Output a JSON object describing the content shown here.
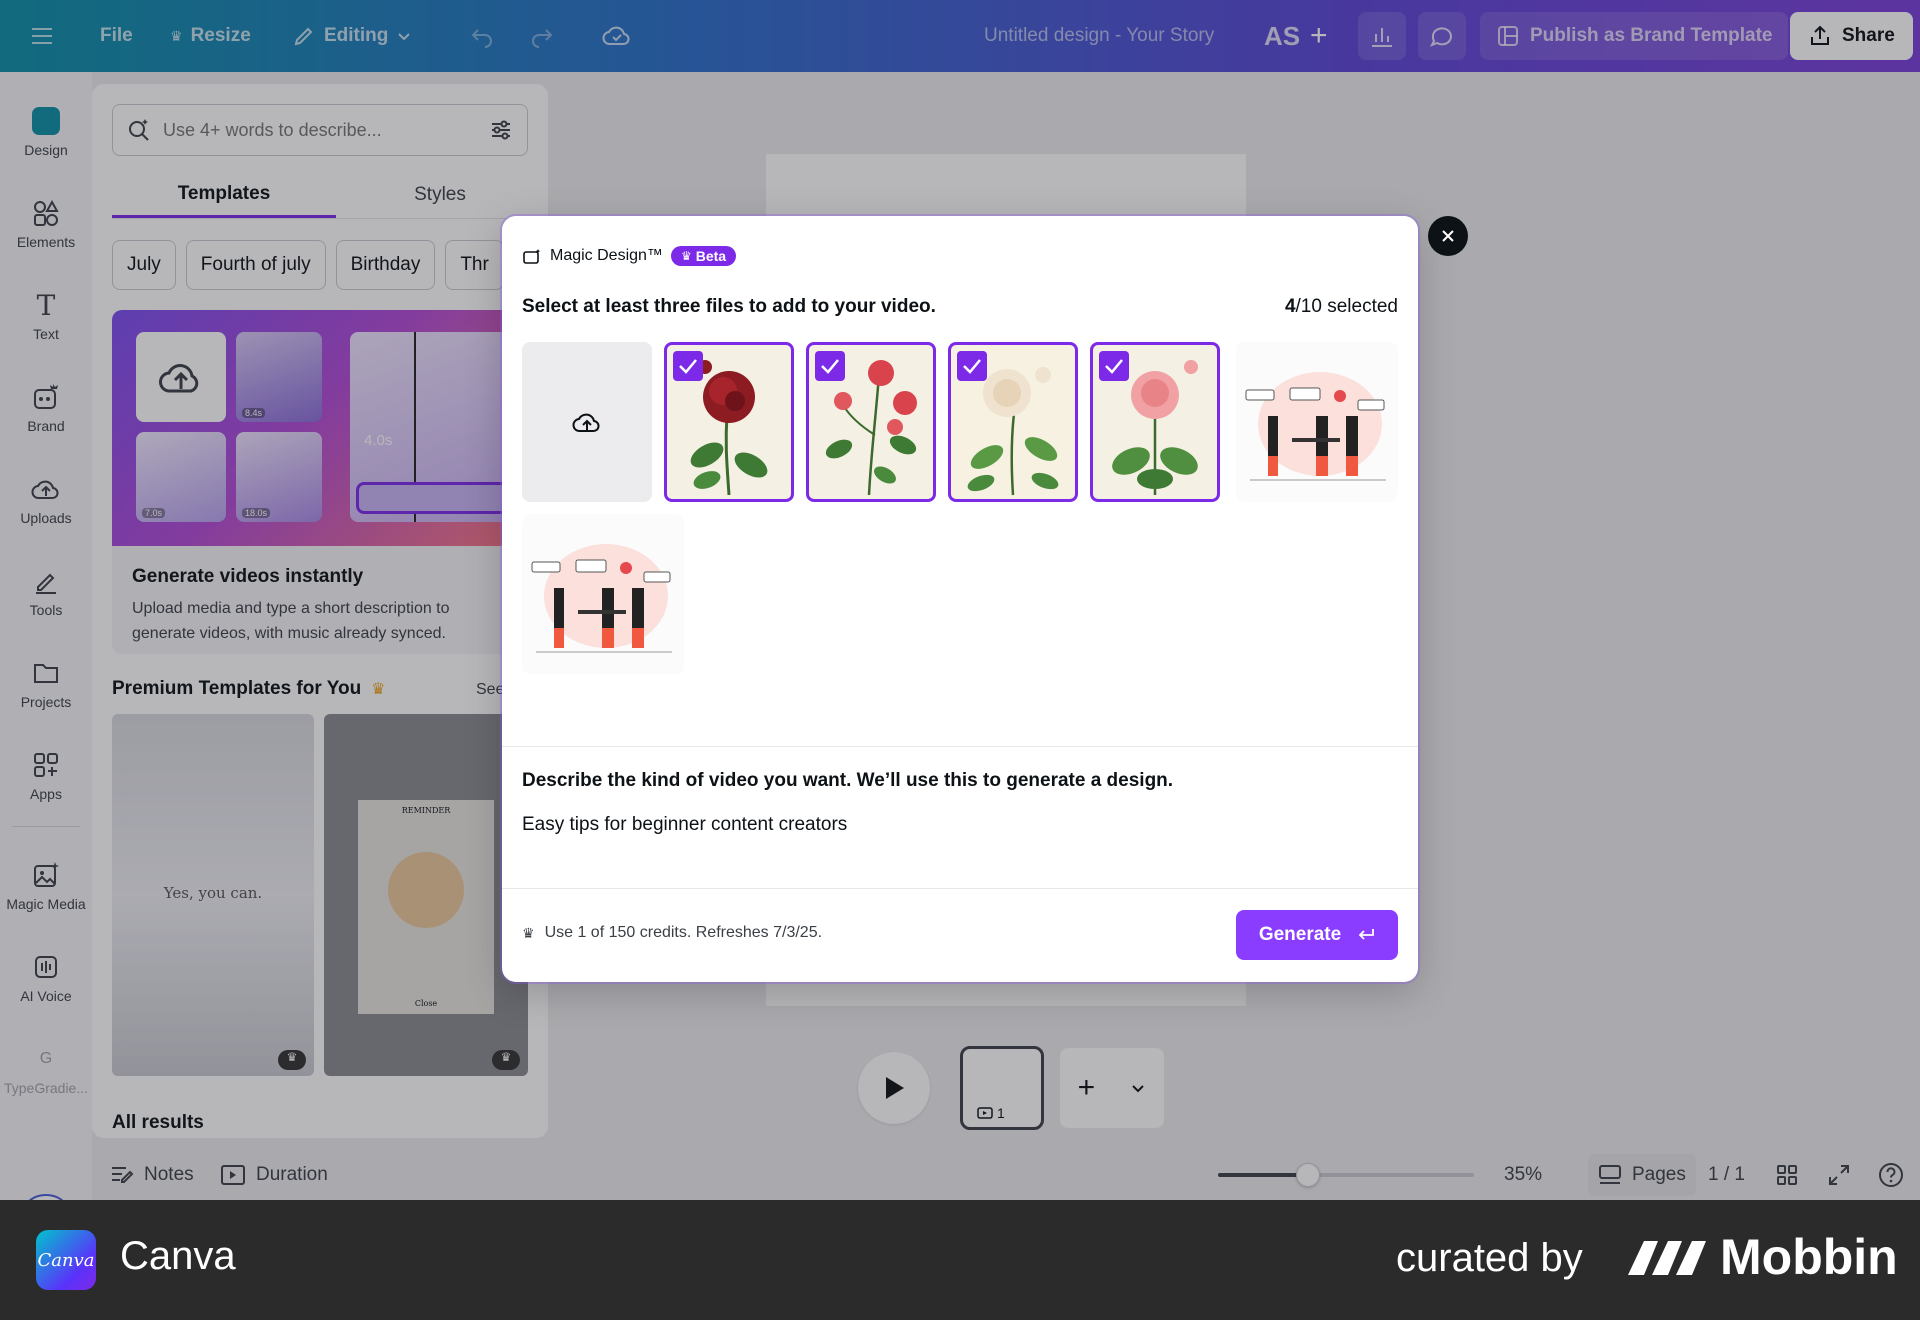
{
  "topbar": {
    "menu_icon": "hamburger-icon",
    "file_label": "File",
    "resize_label": "Resize",
    "editing_label": "Editing",
    "doc_title": "Untitled design - Your Story",
    "avatar_initials": "AS",
    "publish_label": "Publish as Brand Template",
    "share_label": "Share"
  },
  "rail": {
    "items": [
      {
        "label": "Design"
      },
      {
        "label": "Elements"
      },
      {
        "label": "Text"
      },
      {
        "label": "Brand"
      },
      {
        "label": "Uploads"
      },
      {
        "label": "Tools"
      },
      {
        "label": "Projects"
      },
      {
        "label": "Apps"
      },
      {
        "label": "Magic Media"
      },
      {
        "label": "AI Voice"
      },
      {
        "label": "TypeGradie..."
      }
    ]
  },
  "panel": {
    "search_placeholder": "Use 4+ words to describe...",
    "tabs": [
      {
        "label": "Templates"
      },
      {
        "label": "Styles"
      }
    ],
    "chips": [
      {
        "label": "July"
      },
      {
        "label": "Fourth of july"
      },
      {
        "label": "Birthday"
      },
      {
        "label": "Thr"
      }
    ],
    "promo": {
      "title": "Generate videos instantly",
      "description": "Upload media and type a short description to generate videos, with music already synced.",
      "durations": [
        "8.4s",
        "7.0s",
        "18.0s",
        "4.0s"
      ]
    },
    "premium_title": "Premium Templates for You",
    "see_all": "See",
    "templates": [
      {
        "text": "Yes, you can."
      },
      {
        "header": "REMINDER",
        "footer": "Close"
      }
    ],
    "all_results": "All results"
  },
  "canvas": {
    "page_number": "1"
  },
  "bottombar": {
    "notes_label": "Notes",
    "duration_label": "Duration",
    "zoom": "35%",
    "zoom_fraction": 0.35,
    "pages_label": "Pages",
    "page_count": "1 / 1"
  },
  "modal": {
    "title": "Magic Design™",
    "beta_label": "Beta",
    "instruction": "Select at least three files to add to your video.",
    "selected_count": "4",
    "selected_suffix": "/10 selected",
    "files": [
      {
        "kind": "upload",
        "selected": false
      },
      {
        "kind": "red-rose",
        "selected": true
      },
      {
        "kind": "red-rose-branch",
        "selected": true
      },
      {
        "kind": "white-rose",
        "selected": true
      },
      {
        "kind": "pink-rose",
        "selected": true
      },
      {
        "kind": "team-illustration",
        "selected": false
      },
      {
        "kind": "team-illustration",
        "selected": false
      }
    ],
    "description_label": "Describe the kind of video you want. We’ll use this to generate a design.",
    "description_value": "Easy tips for beginner content creators",
    "credits_text": "Use 1 of 150 credits. Refreshes 7/3/25.",
    "generate_label": "Generate"
  },
  "footer": {
    "logo_text": "Canva",
    "app_name": "Canva",
    "curated_by": "curated by",
    "brand": "Mobbin"
  },
  "colors": {
    "accent": "#7d2ae8",
    "generate": "#8b3dff",
    "topbar_start": "#0b8fa6",
    "topbar_end": "#7b3fd8"
  }
}
